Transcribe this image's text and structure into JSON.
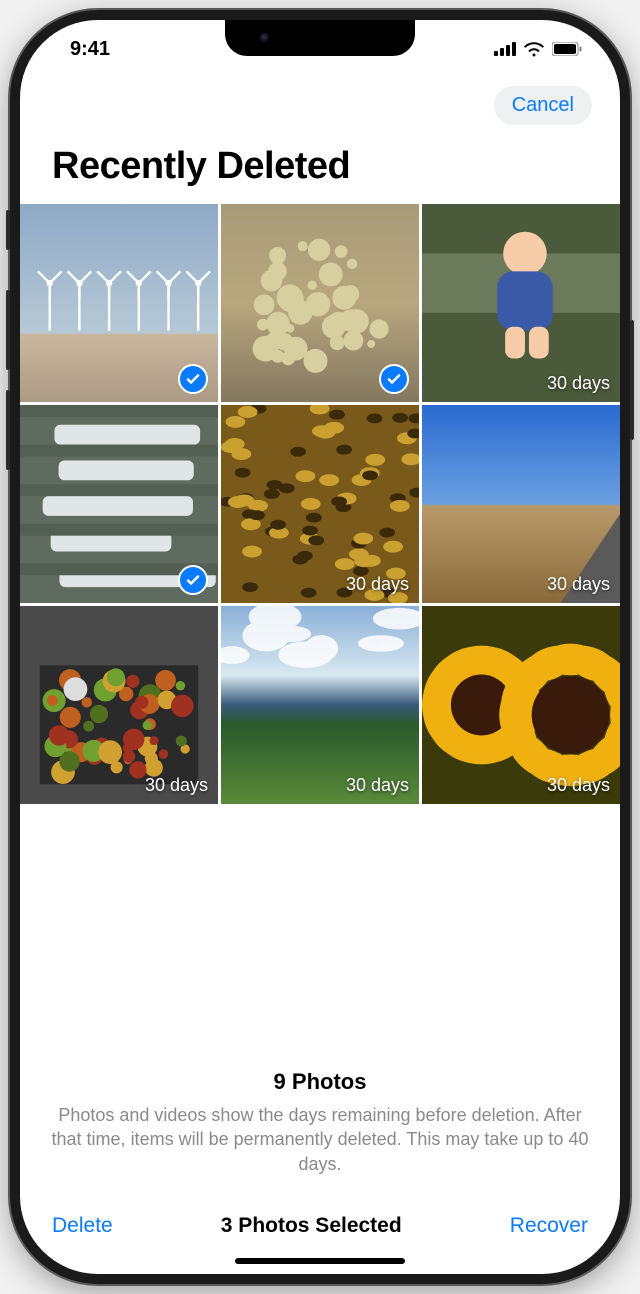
{
  "status": {
    "time": "9:41"
  },
  "nav": {
    "cancel": "Cancel"
  },
  "title": "Recently Deleted",
  "days_label": "30 days",
  "photos": [
    {
      "selected": true,
      "kind": "windfarm"
    },
    {
      "selected": true,
      "kind": "cactus"
    },
    {
      "selected": false,
      "kind": "baby"
    },
    {
      "selected": true,
      "kind": "waterfall"
    },
    {
      "selected": false,
      "kind": "bees"
    },
    {
      "selected": false,
      "kind": "desertroad"
    },
    {
      "selected": false,
      "kind": "compost"
    },
    {
      "selected": false,
      "kind": "meadow"
    },
    {
      "selected": false,
      "kind": "sunflowers"
    }
  ],
  "summary": {
    "count": "9 Photos",
    "desc": "Photos and videos show the days remaining before deletion. After that time, items will be permanently deleted. This may take up to 40 days."
  },
  "toolbar": {
    "delete": "Delete",
    "selected": "3 Photos Selected",
    "recover": "Recover"
  }
}
